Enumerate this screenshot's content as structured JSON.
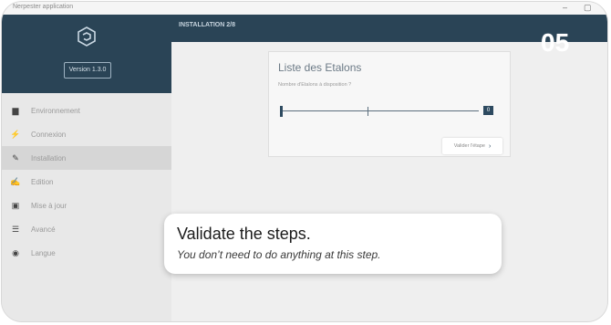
{
  "window": {
    "title": "Nerpester application",
    "controls": [
      "‒",
      "▢"
    ]
  },
  "sidebar": {
    "version_label": "Version 1.3.0",
    "items": [
      {
        "label": "Environnement",
        "icon": "folder-icon",
        "glyph": "▆"
      },
      {
        "label": "Connexion",
        "icon": "lightning-icon",
        "glyph": "⚡"
      },
      {
        "label": "Installation",
        "icon": "wrench-icon",
        "glyph": "✎",
        "active": true
      },
      {
        "label": "Edition",
        "icon": "edit-icon",
        "glyph": "✍"
      },
      {
        "label": "Mise à jour",
        "icon": "update-icon",
        "glyph": "▣"
      },
      {
        "label": "Avancé",
        "icon": "sliders-icon",
        "glyph": "☰"
      },
      {
        "label": "Langue",
        "icon": "globe-icon",
        "glyph": "◉"
      }
    ]
  },
  "topbar": {
    "step_label": "INSTALLATION 2/8"
  },
  "card": {
    "title": "Liste des Etalons",
    "subtitle": "Nombre d'Etalons à disposition ?",
    "slider_value": "0",
    "validate_label": "Valider l'étape",
    "validate_chevron": "›"
  },
  "overlay": {
    "step_number": "05",
    "heading": "Validate the steps.",
    "description": "You don’t need to do anything at this step."
  }
}
